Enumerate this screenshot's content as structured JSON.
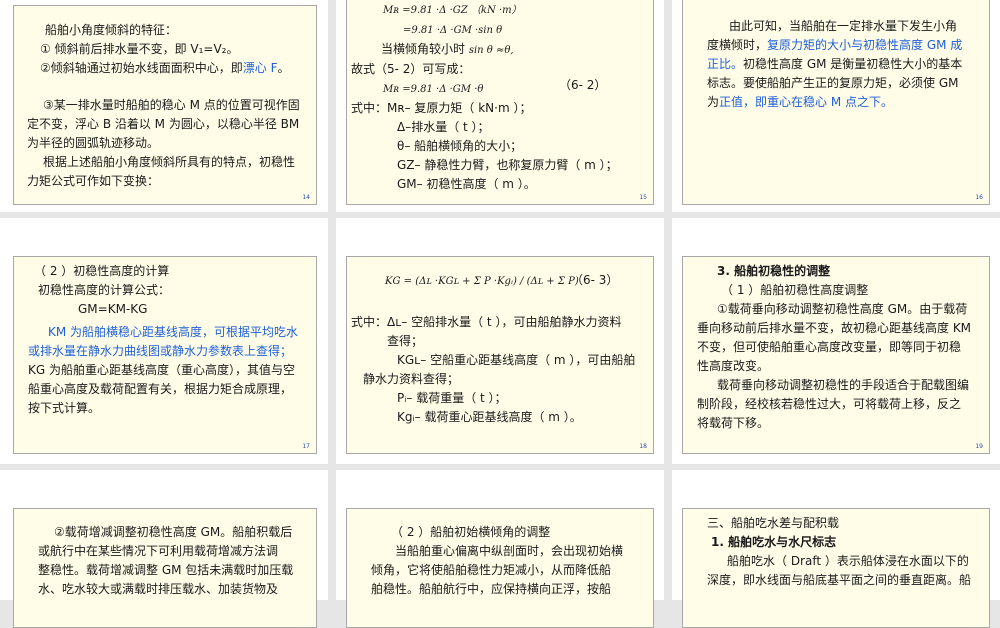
{
  "slides": [
    {
      "num": "14",
      "lines": [
        {
          "parts": [
            {
              "t": "船舶小角度倾斜的特征："
            }
          ]
        },
        {
          "parts": [
            {
              "t": "① 倾斜前后排水量不变，即 V₁=V₂。"
            }
          ]
        },
        {
          "parts": [
            {
              "t": "②倾斜轴通过初始水线面面积中心，即"
            },
            {
              "t": "漂心 F",
              "c": "blue"
            },
            {
              "t": "。"
            }
          ]
        },
        {
          "parts": [
            {
              "t": "③某一排水量时船舶的稳心 M 点的位置可视作固"
            }
          ]
        },
        {
          "parts": [
            {
              "t": "定不变，浮心 B 沿着以 M 为圆心，以稳心半径 BM"
            }
          ]
        },
        {
          "parts": [
            {
              "t": "为半径的圆弧轨迹移动。"
            }
          ]
        },
        {
          "parts": [
            {
              "t": "根据上述船舶小角度倾斜所具有的特点，初稳性"
            }
          ]
        },
        {
          "parts": [
            {
              "t": "力矩公式可作如下变换："
            }
          ]
        }
      ]
    },
    {
      "num": "15",
      "lines": [
        {
          "parts": [
            {
              "t": "Mʀ =9.81 ·Δ ·GZ （kN ·m）",
              "c": "f"
            }
          ]
        },
        {
          "parts": [
            {
              "t": "=9.81 ·Δ ·GM  ·sin θ",
              "c": "f"
            }
          ]
        },
        {
          "parts": [
            {
              "t": "当横倾角较小时 "
            },
            {
              "t": "sin θ ≈θ,",
              "c": "f"
            }
          ]
        },
        {
          "parts": [
            {
              "t": "故式（5- 2）可写成："
            }
          ]
        },
        {
          "parts": [
            {
              "t": "Mʀ =9.81 ·Δ ·GM  ·θ",
              "c": "f"
            }
          ]
        },
        {
          "parts": [
            {
              "t": "（6- 2）"
            }
          ]
        },
        {
          "parts": [
            {
              "t": "式中：Mʀ– 复原力矩（ kN·m ）；"
            }
          ]
        },
        {
          "parts": [
            {
              "t": "Δ–排水量（ t ）；"
            }
          ]
        },
        {
          "parts": [
            {
              "t": "θ– 船舶横倾角的大小；"
            }
          ]
        },
        {
          "parts": [
            {
              "t": "GZ– 静稳性力臂，也称复原力臂（ m ）；"
            }
          ]
        },
        {
          "parts": [
            {
              "t": "GM– 初稳性高度（ m ）。"
            }
          ]
        }
      ]
    },
    {
      "num": "16",
      "lines": [
        {
          "parts": [
            {
              "t": "由此可知，当船舶在一定排水量下发生小角"
            }
          ]
        },
        {
          "parts": [
            {
              "t": "度横倾时，"
            },
            {
              "t": "复原力矩的大小与初稳性高度 GM 成",
              "c": "blue"
            }
          ]
        },
        {
          "parts": [
            {
              "t": "正比。",
              "c": "blue"
            },
            {
              "t": "初稳性高度 GM 是衡量初稳性大小的基本"
            }
          ]
        },
        {
          "parts": [
            {
              "t": "标志。要使船舶产生正的复原力矩，必须使 GM"
            }
          ]
        },
        {
          "parts": [
            {
              "t": "为"
            },
            {
              "t": "正值，即重心在稳心 M 点之下。",
              "c": "blue"
            }
          ]
        }
      ]
    },
    {
      "num": "17",
      "lines": [
        {
          "parts": [
            {
              "t": "（ 2 ）初稳性高度的计算"
            }
          ]
        },
        {
          "parts": [
            {
              "t": "初稳性高度的计算公式："
            }
          ]
        },
        {
          "parts": [
            {
              "t": "GM=KM-KG"
            }
          ]
        },
        {
          "parts": [
            {
              "t": "KM 为船舶横稳心距基线高度，可根据平均吃水",
              "c": "blue"
            }
          ]
        },
        {
          "parts": [
            {
              "t": "或排水量在静水力曲线图或静水力参数表上查得；",
              "c": "blue"
            }
          ]
        },
        {
          "parts": [
            {
              "t": "KG 为船舶重心距基线高度（重心高度），其值与空"
            }
          ]
        },
        {
          "parts": [
            {
              "t": "船重心高度及载荷配置有关，根据力矩合成原理，"
            }
          ]
        },
        {
          "parts": [
            {
              "t": "按下式计算。"
            }
          ]
        }
      ]
    },
    {
      "num": "18",
      "lines": [
        {
          "parts": [
            {
              "t": "KG = (Δʟ ·KGʟ + Σ P ·Kgᵢ) / (Δʟ + Σ P)",
              "c": "f"
            }
          ]
        },
        {
          "parts": [
            {
              "t": "（6- 3）"
            }
          ]
        },
        {
          "parts": [
            {
              "t": "式中：Δʟ– 空船排水量（ t ），可由船舶静水力资料"
            }
          ]
        },
        {
          "parts": [
            {
              "t": "查得；"
            }
          ]
        },
        {
          "parts": [
            {
              "t": "KGʟ– 空船重心距基线高度（ m ），可由船舶"
            }
          ]
        },
        {
          "parts": [
            {
              "t": "静水力资料查得；"
            }
          ]
        },
        {
          "parts": [
            {
              "t": "Pᵢ– 载荷重量（ t ）；"
            }
          ]
        },
        {
          "parts": [
            {
              "t": "Kgᵢ– 载荷重心距基线高度（ m ）。"
            }
          ]
        }
      ]
    },
    {
      "num": "19",
      "lines": [
        {
          "parts": [
            {
              "t": "3. 船舶初稳性的调整",
              "c": "b"
            }
          ]
        },
        {
          "parts": [
            {
              "t": "（ 1 ）船舶初稳性高度调整"
            }
          ]
        },
        {
          "parts": [
            {
              "t": "①载荷垂向移动调整初稳性高度 GM。由于载荷"
            }
          ]
        },
        {
          "parts": [
            {
              "t": "垂向移动前后排水量不变，故初稳心距基线高度 KM"
            }
          ]
        },
        {
          "parts": [
            {
              "t": "不变，但可使船舶重心高度改变量，即等同于初稳"
            }
          ]
        },
        {
          "parts": [
            {
              "t": "性高度改变。"
            }
          ]
        },
        {
          "parts": [
            {
              "t": "载荷垂向移动调整初稳性的手段适合于配载图编"
            }
          ]
        },
        {
          "parts": [
            {
              "t": "制阶段，经校核若稳性过大，可将载荷上移，反之"
            }
          ]
        },
        {
          "parts": [
            {
              "t": "将载荷下移。"
            }
          ]
        }
      ]
    },
    {
      "num": "",
      "lines": [
        {
          "parts": [
            {
              "t": "②载荷增减调整初稳性高度 GM。船舶积载后"
            }
          ]
        },
        {
          "parts": [
            {
              "t": "或航行中在某些情况下可利用载荷增减方法调"
            }
          ]
        },
        {
          "parts": [
            {
              "t": "整稳性。载荷增减调整 GM 包括未满载时加压载"
            }
          ]
        },
        {
          "parts": [
            {
              "t": "水、吃水较大或满载时排压载水、加装货物及"
            }
          ]
        }
      ]
    },
    {
      "num": "",
      "lines": [
        {
          "parts": [
            {
              "t": "（ 2 ）船舶初始横倾角的调整"
            }
          ]
        },
        {
          "parts": [
            {
              "t": "当船舶重心偏离中纵剖面时，会出现初始横"
            }
          ]
        },
        {
          "parts": [
            {
              "t": "倾角，它将使船舶稳性力矩减小，从而降低船"
            }
          ]
        },
        {
          "parts": [
            {
              "t": "舶稳性。船舶航行中，应保持横向正浮，按船"
            }
          ]
        }
      ]
    },
    {
      "num": "",
      "lines": [
        {
          "parts": [
            {
              "t": "三、船舶吃水差与配积载"
            }
          ]
        },
        {
          "parts": [
            {
              "t": "1. 船舶吃水与水尺标志",
              "c": "b"
            }
          ]
        },
        {
          "parts": [
            {
              "t": "船舶吃水（ Draft ）表示船体浸在水面以下的"
            }
          ]
        },
        {
          "parts": [
            {
              "t": "深度，即水线面与船底基平面之间的垂直距离。船"
            }
          ]
        }
      ]
    }
  ]
}
